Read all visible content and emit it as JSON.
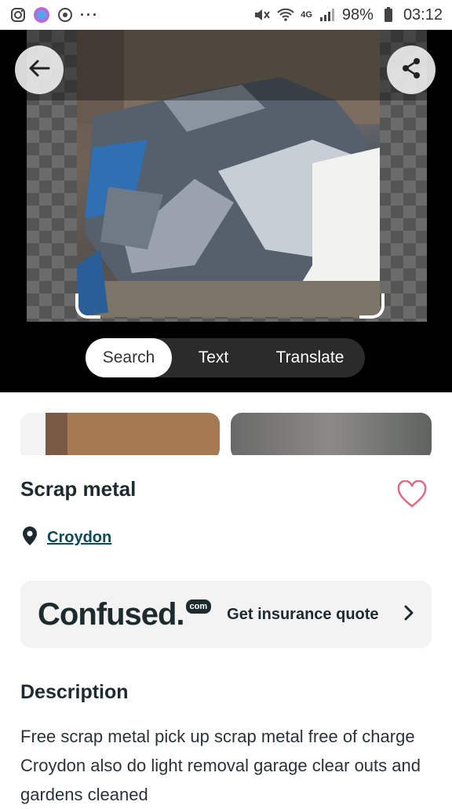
{
  "status_bar": {
    "left_icons": [
      "instagram-icon",
      "messenger-icon",
      "sync-icon"
    ],
    "overflow": "···",
    "network": "4G",
    "battery": "98%",
    "time": "03:12"
  },
  "lens": {
    "modes": [
      "Search",
      "Text",
      "Translate"
    ],
    "active_mode": "Search"
  },
  "listing": {
    "title": "Scrap metal",
    "location": "Croydon",
    "promo": {
      "logo": "Confused.",
      "logo_badge": "com",
      "cta": "Get insurance quote"
    },
    "description_heading": "Description",
    "description": "Free scrap metal pick up scrap metal free of charge Croydon also do light removal garage clear outs and gardens cleaned"
  },
  "colors": {
    "accent_link": "#0c4a57",
    "heart": "#e06a86",
    "chip_bg": "#2b2b2b"
  }
}
